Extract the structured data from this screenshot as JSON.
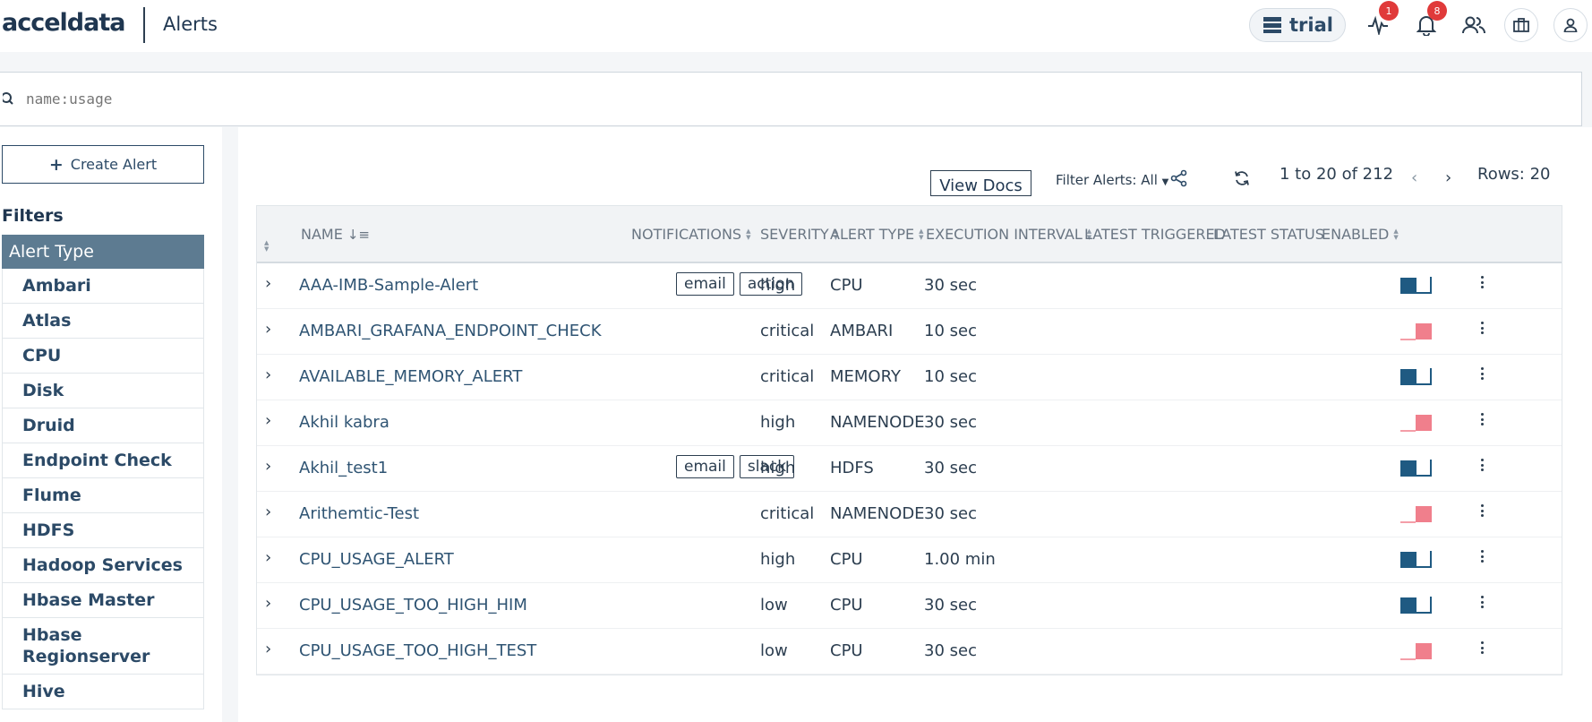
{
  "header": {
    "logo": "acceldata",
    "app_title": "Alerts",
    "trial_label": "trial",
    "activity_badge": "1",
    "notifications_badge": "8"
  },
  "search": {
    "placeholder": "name:usage"
  },
  "sidebar": {
    "create_label": "Create Alert",
    "filters_title": "Filters",
    "filter_group": "Alert Type",
    "items": [
      "Ambari",
      "Atlas",
      "CPU",
      "Disk",
      "Druid",
      "Endpoint Check",
      "Flume",
      "HDFS",
      "Hadoop Services",
      "Hbase Master",
      "Hbase Regionserver",
      "Hive"
    ]
  },
  "toolbar": {
    "view_docs": "View Docs",
    "filter_alerts": "Filter Alerts: All",
    "pager_text": "1 to 20 of 212",
    "rows_label": "Rows: 20"
  },
  "table": {
    "columns": {
      "name": "NAME",
      "notifications": "NOTIFICATIONS",
      "severity": "SEVERITY",
      "alert_type": "ALERT TYPE",
      "execution_interval": "EXECUTION INTERVAL",
      "latest_triggered": "LATEST TRIGGERED",
      "latest_status": "LATEST STATUS",
      "enabled": "ENABLED"
    },
    "rows": [
      {
        "name": "AAA-IMB-Sample-Alert",
        "notifications": [
          "email",
          "action"
        ],
        "severity": "high",
        "type": "CPU",
        "interval": "30 sec",
        "enabled": true
      },
      {
        "name": "AMBARI_GRAFANA_ENDPOINT_CHECK",
        "notifications": [],
        "severity": "critical",
        "type": "AMBARI",
        "interval": "10 sec",
        "enabled": false
      },
      {
        "name": "AVAILABLE_MEMORY_ALERT",
        "notifications": [],
        "severity": "critical",
        "type": "MEMORY",
        "interval": "10 sec",
        "enabled": true
      },
      {
        "name": "Akhil kabra",
        "notifications": [],
        "severity": "high",
        "type": "NAMENODE",
        "interval": "30 sec",
        "enabled": false
      },
      {
        "name": "Akhil_test1",
        "notifications": [
          "email",
          "slack"
        ],
        "severity": "high",
        "type": "HDFS",
        "interval": "30 sec",
        "enabled": true
      },
      {
        "name": "Arithemtic-Test",
        "notifications": [],
        "severity": "critical",
        "type": "NAMENODE",
        "interval": "30 sec",
        "enabled": false
      },
      {
        "name": "CPU_USAGE_ALERT",
        "notifications": [],
        "severity": "high",
        "type": "CPU",
        "interval": "1.00 min",
        "enabled": true
      },
      {
        "name": "CPU_USAGE_TOO_HIGH_HIM",
        "notifications": [],
        "severity": "low",
        "type": "CPU",
        "interval": "30 sec",
        "enabled": true
      },
      {
        "name": "CPU_USAGE_TOO_HIGH_TEST",
        "notifications": [],
        "severity": "low",
        "type": "CPU",
        "interval": "30 sec",
        "enabled": false
      }
    ]
  },
  "colors": {
    "toggle_on": "#1f5a82",
    "toggle_off": "#f07f8c",
    "filter_header_bg": "#5d7b91",
    "badge": "#e03a3a"
  }
}
